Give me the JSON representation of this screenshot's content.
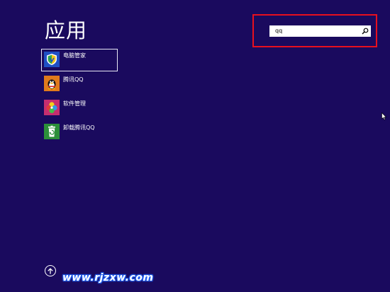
{
  "page": {
    "title": "应用"
  },
  "apps": [
    {
      "label": "电脑管家",
      "icon": "pc-manager-shield-icon",
      "selected": true
    },
    {
      "label": "腾讯QQ",
      "icon": "qq-penguin-icon",
      "selected": false
    },
    {
      "label": "软件管理",
      "icon": "software-manager-clover-icon",
      "selected": false
    },
    {
      "label": "卸载腾讯QQ",
      "icon": "uninstall-recycle-icon",
      "selected": false
    }
  ],
  "search": {
    "value": "qq",
    "placeholder": "",
    "icon": "search-icon"
  },
  "colors": {
    "background": "#1a0a5e",
    "highlight_border": "#e8101e",
    "selected_border": "#e8e8f5"
  },
  "navigation": {
    "scroll_up_icon": "arrow-up-circle-icon"
  },
  "watermark": {
    "text": "www.rjzxw.com"
  }
}
